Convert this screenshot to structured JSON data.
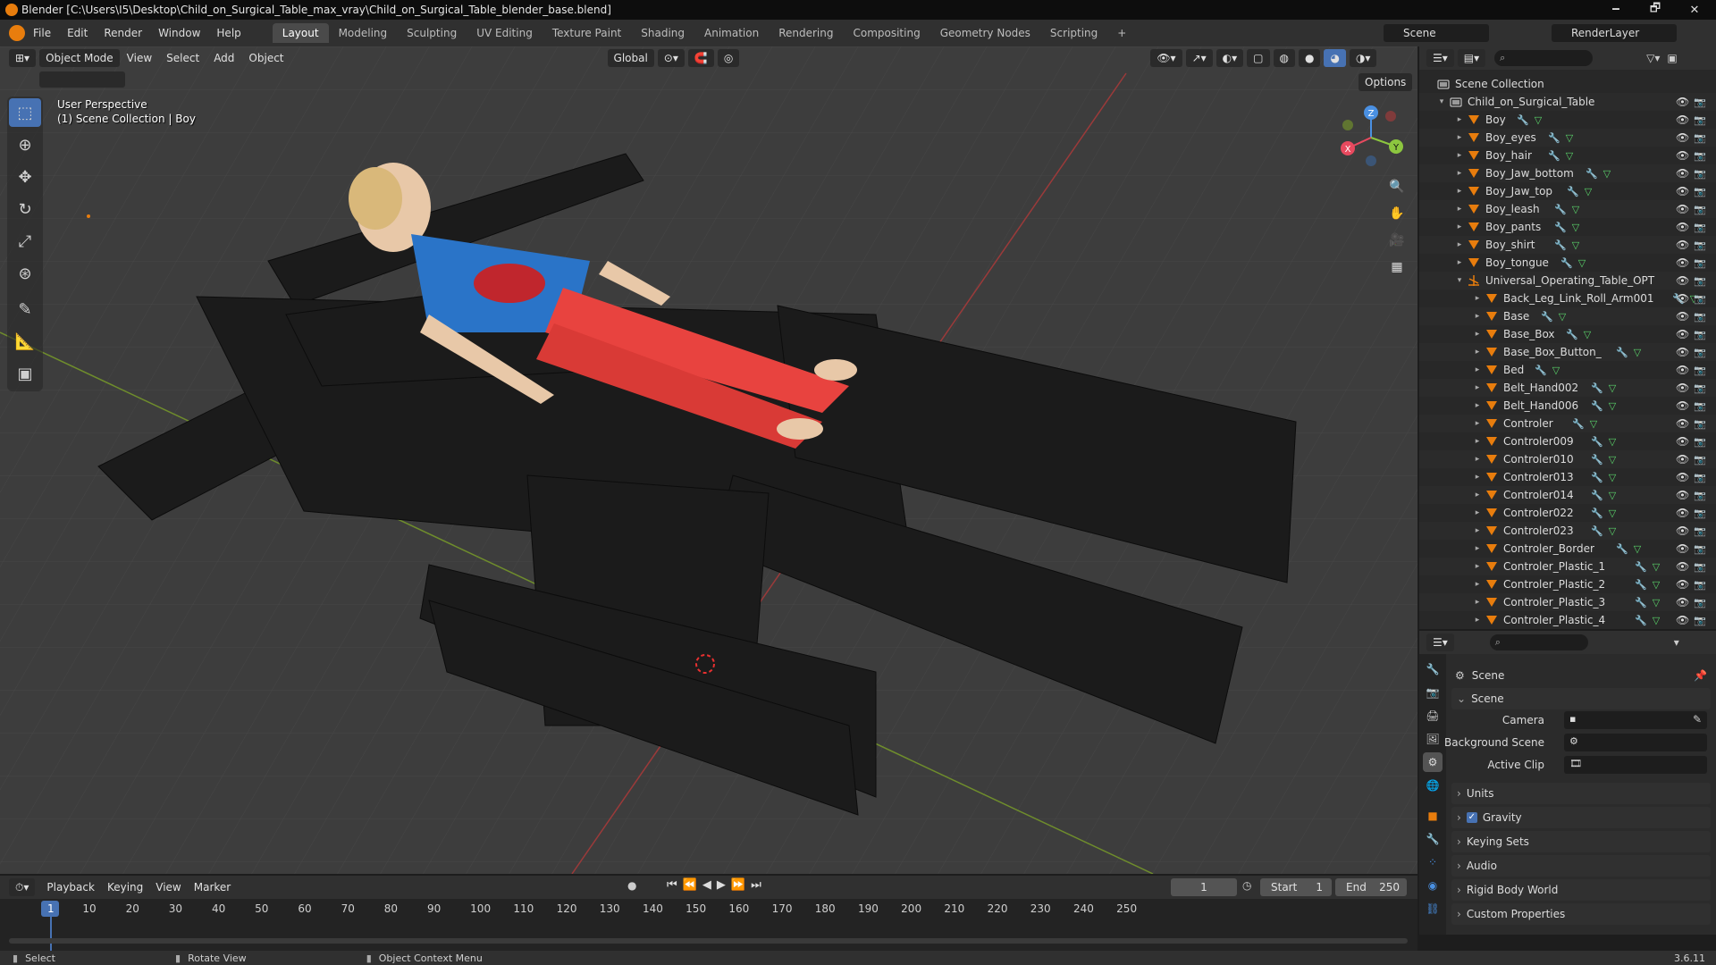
{
  "window": {
    "title": "Blender [C:\\Users\\I5\\Desktop\\Child_on_Surgical_Table_max_vray\\Child_on_Surgical_Table_blender_base.blend]",
    "minimize": "🗕",
    "maximize": "🗗",
    "close": "✕"
  },
  "menubar": {
    "items": [
      "File",
      "Edit",
      "Render",
      "Window",
      "Help"
    ],
    "workspaces": [
      "Layout",
      "Modeling",
      "Sculpting",
      "UV Editing",
      "Texture Paint",
      "Shading",
      "Animation",
      "Rendering",
      "Compositing",
      "Geometry Nodes",
      "Scripting"
    ],
    "active_workspace": "Layout",
    "add_tab": "+",
    "scene": "Scene",
    "view_layer": "RenderLayer"
  },
  "viewport": {
    "mode": "Object Mode",
    "menus": [
      "View",
      "Select",
      "Add",
      "Object"
    ],
    "orientation": "Global",
    "options_label": "Options",
    "overlay_line1": "User Perspective",
    "overlay_line2": "(1) Scene Collection | Boy",
    "gizmo": {
      "x": "X",
      "y": "Y",
      "z": "Z"
    }
  },
  "outliner": {
    "root": "Scene Collection",
    "collection": "Child_on_Surgical_Table",
    "items": [
      {
        "name": "Boy",
        "level": 2
      },
      {
        "name": "Boy_eyes",
        "level": 2
      },
      {
        "name": "Boy_hair",
        "level": 2
      },
      {
        "name": "Boy_Jaw_bottom",
        "level": 2
      },
      {
        "name": "Boy_Jaw_top",
        "level": 2
      },
      {
        "name": "Boy_leash",
        "level": 2
      },
      {
        "name": "Boy_pants",
        "level": 2
      },
      {
        "name": "Boy_shirt",
        "level": 2
      },
      {
        "name": "Boy_tongue",
        "level": 2
      },
      {
        "name": "Universal_Operating_Table_OPT",
        "level": 2,
        "expanded": true
      },
      {
        "name": "Back_Leg_Link_Roll_Arm001",
        "level": 3
      },
      {
        "name": "Base",
        "level": 3
      },
      {
        "name": "Base_Box",
        "level": 3
      },
      {
        "name": "Base_Box_Button_",
        "level": 3
      },
      {
        "name": "Bed",
        "level": 3
      },
      {
        "name": "Belt_Hand002",
        "level": 3
      },
      {
        "name": "Belt_Hand006",
        "level": 3
      },
      {
        "name": "Controler",
        "level": 3
      },
      {
        "name": "Controler009",
        "level": 3
      },
      {
        "name": "Controler010",
        "level": 3
      },
      {
        "name": "Controler013",
        "level": 3
      },
      {
        "name": "Controler014",
        "level": 3
      },
      {
        "name": "Controler022",
        "level": 3
      },
      {
        "name": "Controler023",
        "level": 3
      },
      {
        "name": "Controler_Border",
        "level": 3
      },
      {
        "name": "Controler_Plastic_1",
        "level": 3
      },
      {
        "name": "Controler_Plastic_2",
        "level": 3
      },
      {
        "name": "Controler_Plastic_3",
        "level": 3
      },
      {
        "name": "Controler_Plastic_4",
        "level": 3
      }
    ]
  },
  "properties": {
    "context": "Scene",
    "panel_title": "Scene",
    "fields": [
      {
        "label": "Camera",
        "value": ""
      },
      {
        "label": "Background Scene",
        "value": ""
      },
      {
        "label": "Active Clip",
        "value": ""
      }
    ],
    "sections": [
      "Units",
      "Gravity",
      "Keying Sets",
      "Audio",
      "Rigid Body World",
      "Custom Properties"
    ],
    "gravity_checked": true
  },
  "timeline": {
    "menus": [
      "Playback",
      "Keying",
      "View",
      "Marker"
    ],
    "current_frame": "1",
    "start_label": "Start",
    "start": "1",
    "end_label": "End",
    "end": "250",
    "ticks": [
      "1",
      "10",
      "20",
      "30",
      "40",
      "50",
      "60",
      "70",
      "80",
      "90",
      "100",
      "110",
      "120",
      "130",
      "140",
      "150",
      "160",
      "170",
      "180",
      "190",
      "200",
      "210",
      "220",
      "230",
      "240",
      "250"
    ]
  },
  "statusbar": {
    "select": "Select",
    "rotate": "Rotate View",
    "context_menu": "Object Context Menu",
    "version": "3.6.11"
  },
  "colors": {
    "accent": "#4772b3",
    "orange": "#e87d0d",
    "panel": "#303030",
    "x_axis": "#e84a5f",
    "y_axis": "#8cc63f",
    "z_axis": "#4a90e2"
  }
}
